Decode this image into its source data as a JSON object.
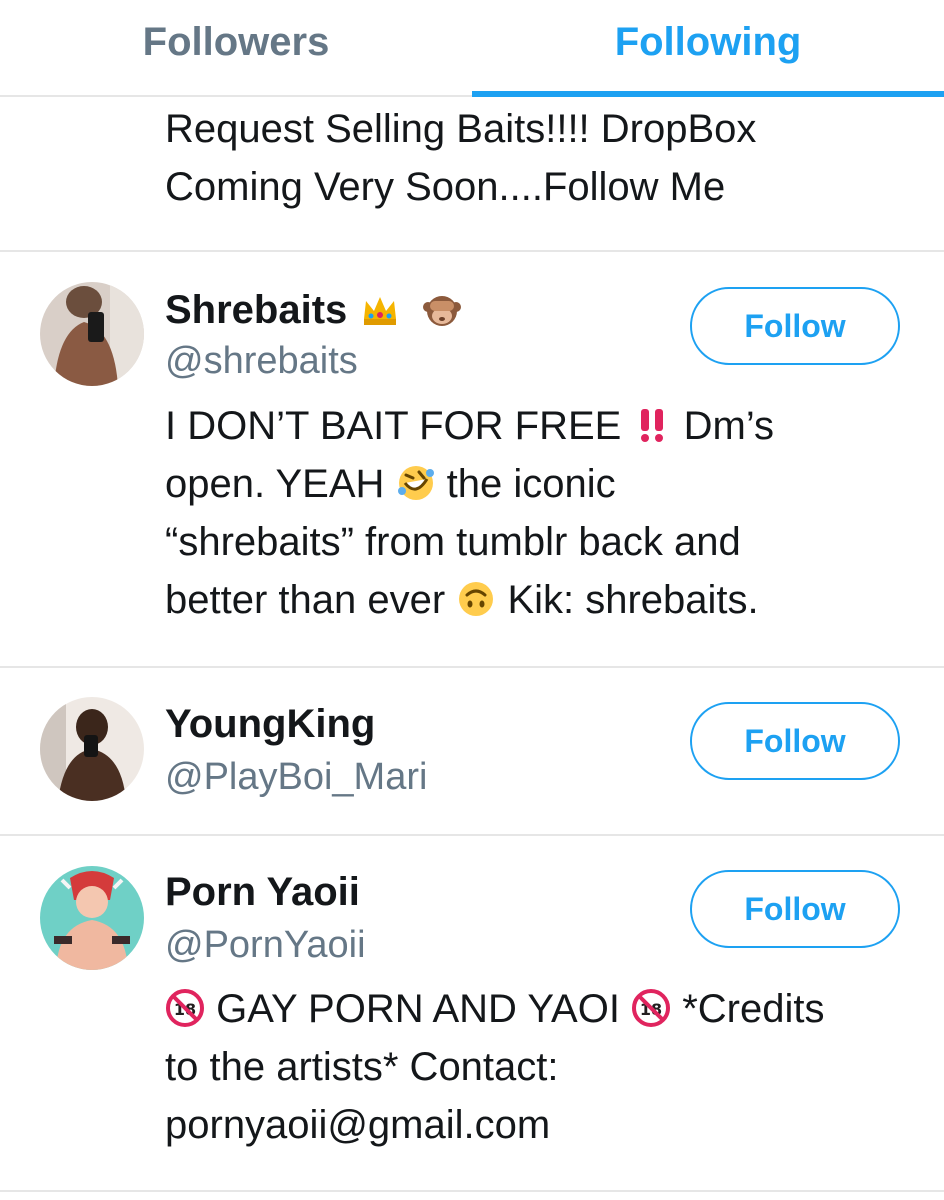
{
  "tabs": {
    "followers": "Followers",
    "following": "Following",
    "active": "Following"
  },
  "top_bio": {
    "line1": "Request Selling Baits!!!! DropBox",
    "line2": "Coming Very Soon....Follow Me"
  },
  "users": [
    {
      "name": "Shrebaits",
      "name_emojis": [
        "crown-emoji",
        "see-no-evil-monkey-emoji"
      ],
      "handle": "@shrebaits",
      "follow_label": "Follow",
      "bio": {
        "l1a": "I DON’T BAIT FOR FREE",
        "l1b": " Dm’s",
        "l2a": "open. YEAH",
        "l2b": " the iconic",
        "l3": "“shrebaits” from tumblr back and",
        "l4a": "better than ever",
        "l4b": " Kik: shrebaits."
      }
    },
    {
      "name": "YoungKing",
      "handle": "@PlayBoi_Mari",
      "follow_label": "Follow"
    },
    {
      "name": "Porn Yaoii",
      "handle": "@PornYaoii",
      "follow_label": "Follow",
      "bio": {
        "l1a": "GAY PORN AND YAOI",
        "l1b": " *Credits",
        "l2": "to the artists* Contact:",
        "l3": "pornyaoii@gmail.com"
      }
    }
  ],
  "colors": {
    "accent": "#1da1f2",
    "secondary_text": "#657786",
    "divider": "#e6e6e6"
  }
}
